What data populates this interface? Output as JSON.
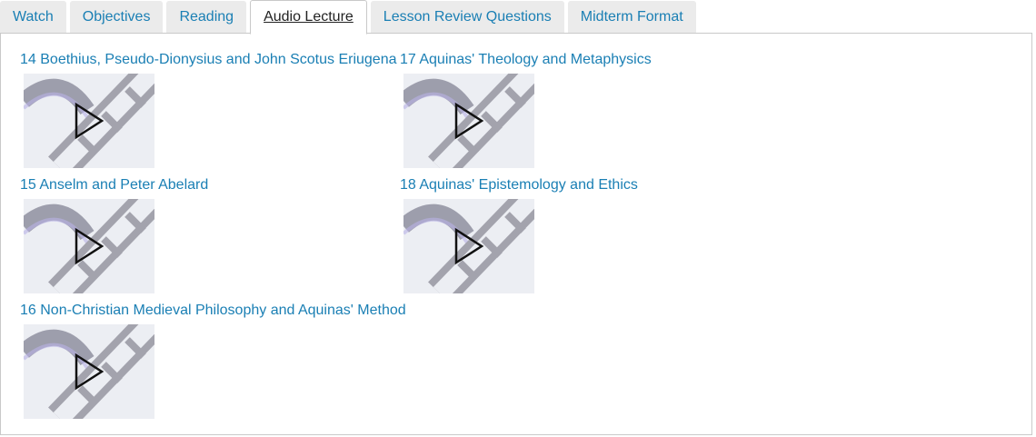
{
  "tabs": [
    {
      "label": "Watch",
      "active": false
    },
    {
      "label": "Objectives",
      "active": false
    },
    {
      "label": "Reading",
      "active": false
    },
    {
      "label": "Audio Lecture",
      "active": true
    },
    {
      "label": "Lesson Review Questions",
      "active": false
    },
    {
      "label": "Midterm Format",
      "active": false
    }
  ],
  "lectures": [
    {
      "title": "14 Boethius, Pseudo-Dionysius and John Scotus Eriugena",
      "thumbnail_icon": "play-icon"
    },
    {
      "title": "15 Anselm and Peter Abelard",
      "thumbnail_icon": "play-icon"
    },
    {
      "title": "16 Non-Christian Medieval Philosophy and Aquinas' Method",
      "thumbnail_icon": "play-icon"
    },
    {
      "title": "17 Aquinas' Theology and Metaphysics",
      "thumbnail_icon": "play-icon"
    },
    {
      "title": "18 Aquinas' Epistemology and Ethics",
      "thumbnail_icon": "play-icon"
    }
  ],
  "colors": {
    "link": "#1a7fb4",
    "tab_bg": "#ebebeb",
    "border": "#c9c9c9"
  }
}
